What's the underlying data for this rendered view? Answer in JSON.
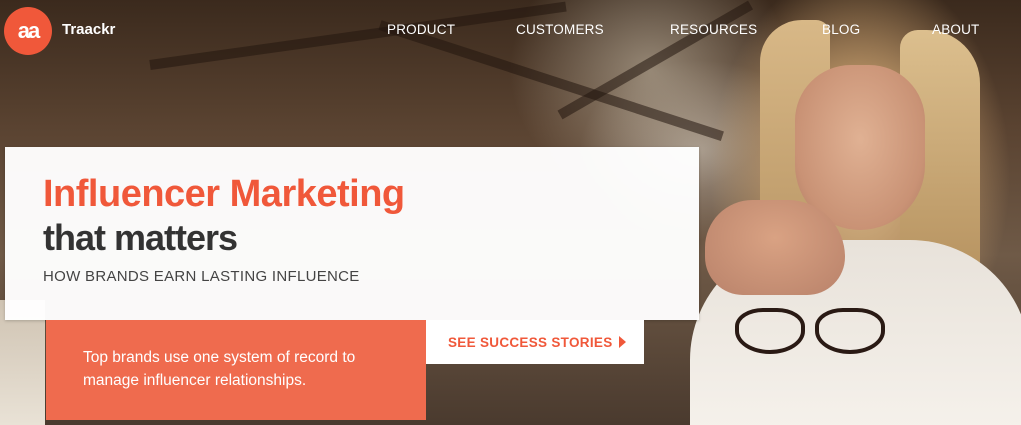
{
  "brand": {
    "logo_text": "aa",
    "name": "Traackr",
    "accent_color": "#f0583a"
  },
  "nav": {
    "items": [
      {
        "label": "PRODUCT"
      },
      {
        "label": "CUSTOMERS"
      },
      {
        "label": "RESOURCES"
      },
      {
        "label": "BLOG"
      },
      {
        "label": "ABOUT"
      }
    ]
  },
  "hero": {
    "headline": "Influencer Marketing",
    "subheadline": "that matters",
    "tagline": "HOW BRANDS EARN LASTING INFLUENCE",
    "description": "Top brands use one system of record to manage influencer relationships.",
    "cta_label": "SEE SUCCESS STORIES",
    "cta_icon": "triangle-right-icon"
  }
}
